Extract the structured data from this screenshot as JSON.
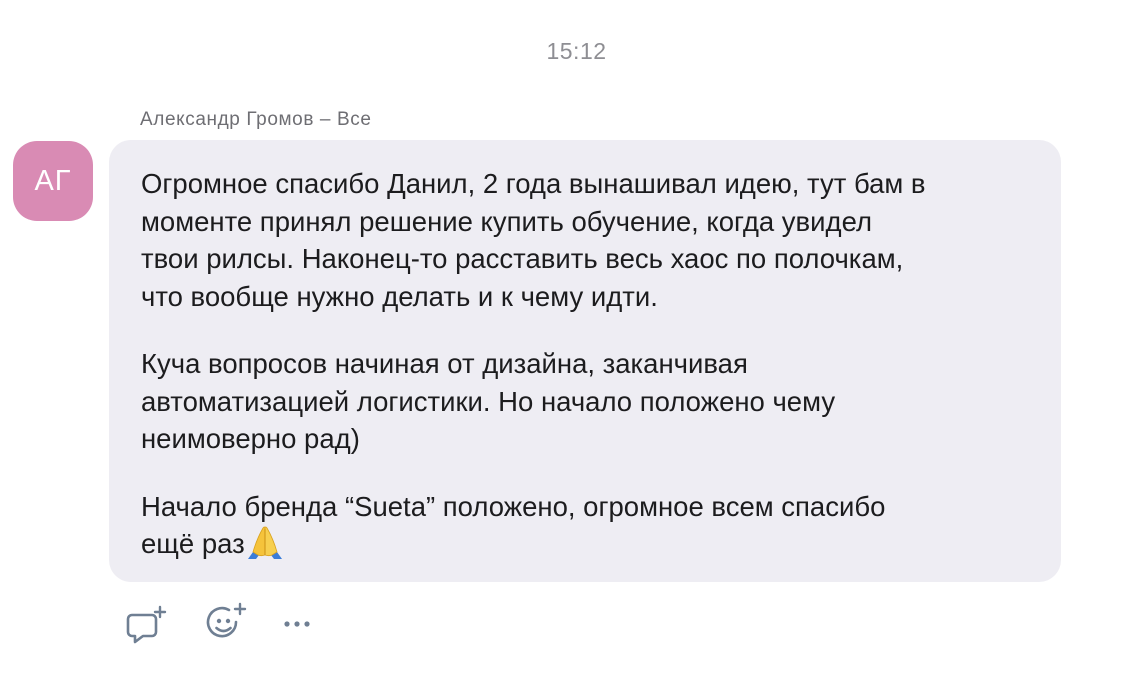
{
  "time": "15:12",
  "message": {
    "sender_line": "Александр Громов – Все",
    "avatar_initials": "АГ",
    "avatar_color": "#d98bb4",
    "bubble_color": "#eeedf3",
    "paragraphs": [
      "Огромное спасибо Данил, 2 года вынашивал идею, тут бам в\nмоменте принял решение купить обучение, когда увидел\nтвои рилсы. Наконец-то расставить весь хаос по полочкам,\nчто вообще нужно делать и к чему идти.",
      "Куча вопросов начиная от дизайна, заканчивая\nавтоматизацией логистики. Но начало положено чему\nнеимоверно рад)",
      "Начало бренда “Sueta” положено, огромное всем спасибо\nещё раз"
    ],
    "trailing_emoji": "folded-hands-emoji"
  },
  "actions": {
    "reply_icon": "reply-comment-icon",
    "react_icon": "add-reaction-icon",
    "more_icon": "more-options-icon"
  }
}
